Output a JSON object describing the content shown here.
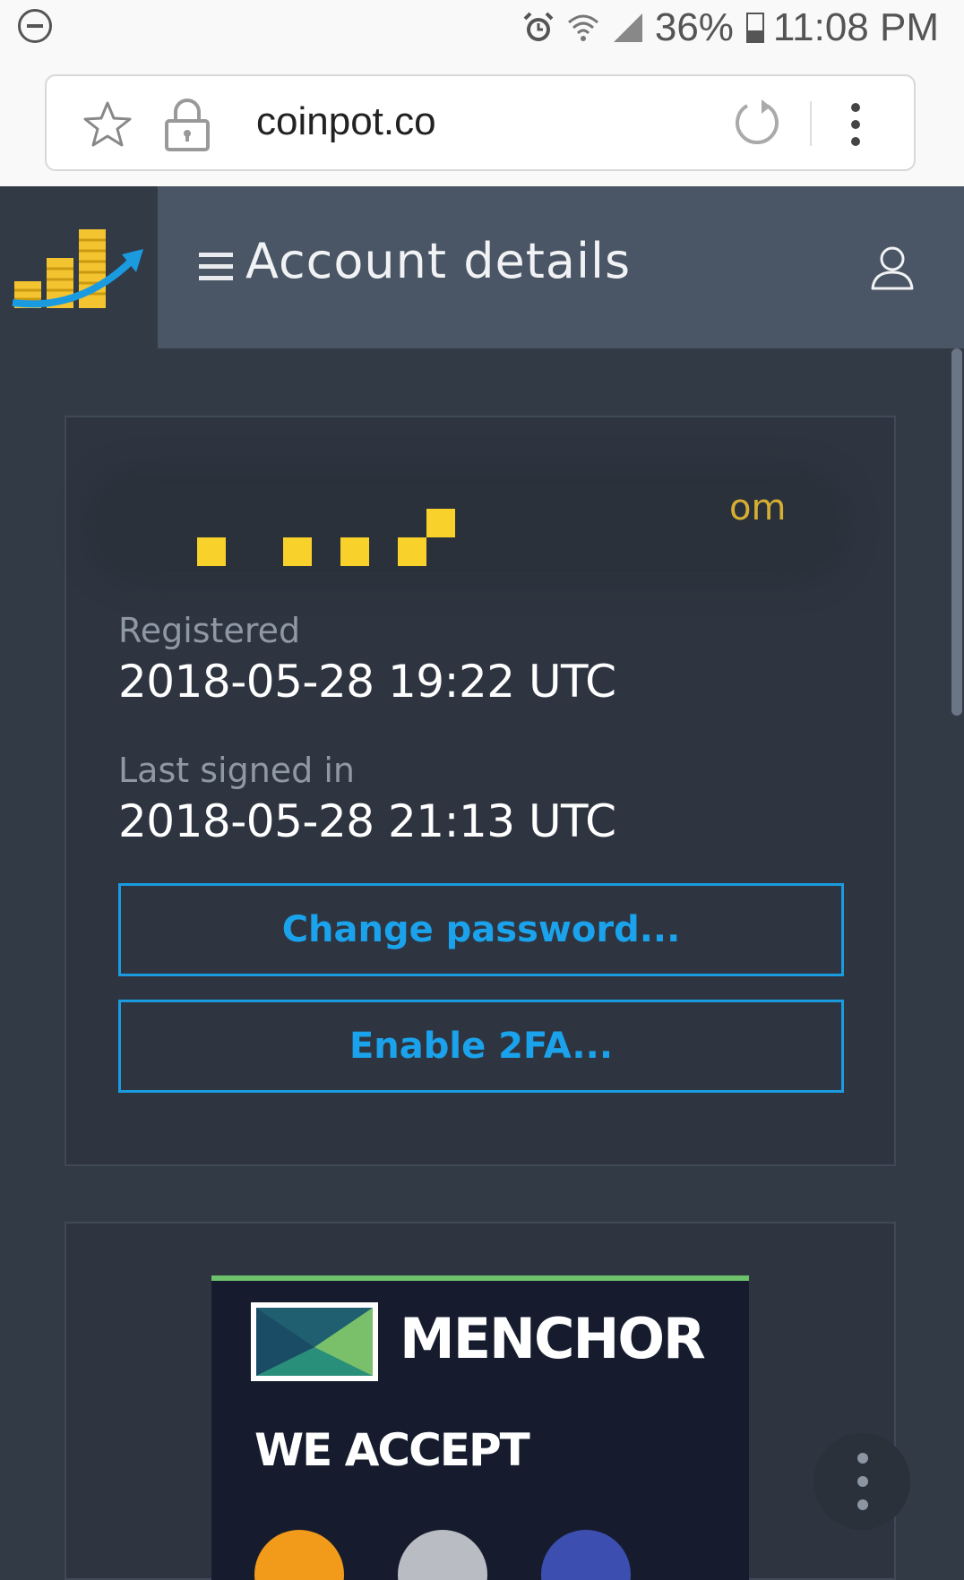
{
  "status_bar": {
    "battery_percent": "36%",
    "time": "11:08 PM",
    "icons": [
      "do-not-disturb-icon",
      "alarm-icon",
      "wifi-icon",
      "signal-icon",
      "battery-icon"
    ]
  },
  "browser": {
    "url": "coinpot.co",
    "icons": [
      "bookmark-star-icon",
      "lock-icon",
      "reload-icon",
      "overflow-menu-icon"
    ]
  },
  "header": {
    "title": "Account details",
    "icons": [
      "coinpot-logo",
      "hamburger-menu-icon",
      "user-profile-icon"
    ]
  },
  "account": {
    "email_suffix": "om",
    "registered_label": "Registered",
    "registered_value": "2018-05-28 19:22 UTC",
    "last_signed_in_label": "Last signed in",
    "last_signed_in_value": "2018-05-28 21:13 UTC",
    "change_password_label": "Change password...",
    "enable_2fa_label": "Enable 2FA..."
  },
  "ad": {
    "brand": "MENCHOR",
    "tagline": "WE ACCEPT"
  },
  "colors": {
    "page_bg": "#323a45",
    "header_bg": "#4a5565",
    "card_bg": "#2e3540",
    "accent_blue": "#1a9be0",
    "logo_gold": "#f4c430"
  }
}
